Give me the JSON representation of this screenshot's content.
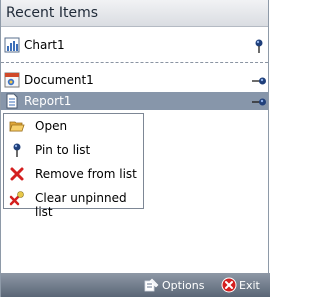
{
  "header": {
    "title": "Recent Items"
  },
  "pinned_items": [
    {
      "label": "Chart1",
      "icon": "chart-icon",
      "pinned": true
    }
  ],
  "recent_items": [
    {
      "label": "Document1",
      "icon": "document-icon",
      "pinned": false
    },
    {
      "label": "Report1",
      "icon": "report-icon",
      "pinned": false,
      "selected": true
    }
  ],
  "context_menu": {
    "items": [
      {
        "label": "Open",
        "icon": "folder-open-icon"
      },
      {
        "label": "Pin to list",
        "icon": "pin-icon"
      },
      {
        "label": "Remove from list",
        "icon": "remove-icon"
      },
      {
        "label": "Clear unpinned list",
        "icon": "clear-list-icon"
      }
    ]
  },
  "footer": {
    "options_label": "Options",
    "exit_label": "Exit"
  },
  "colors": {
    "selection": "#8796aa",
    "footer": "#6f7a89",
    "exit_red": "#d41f1f"
  }
}
